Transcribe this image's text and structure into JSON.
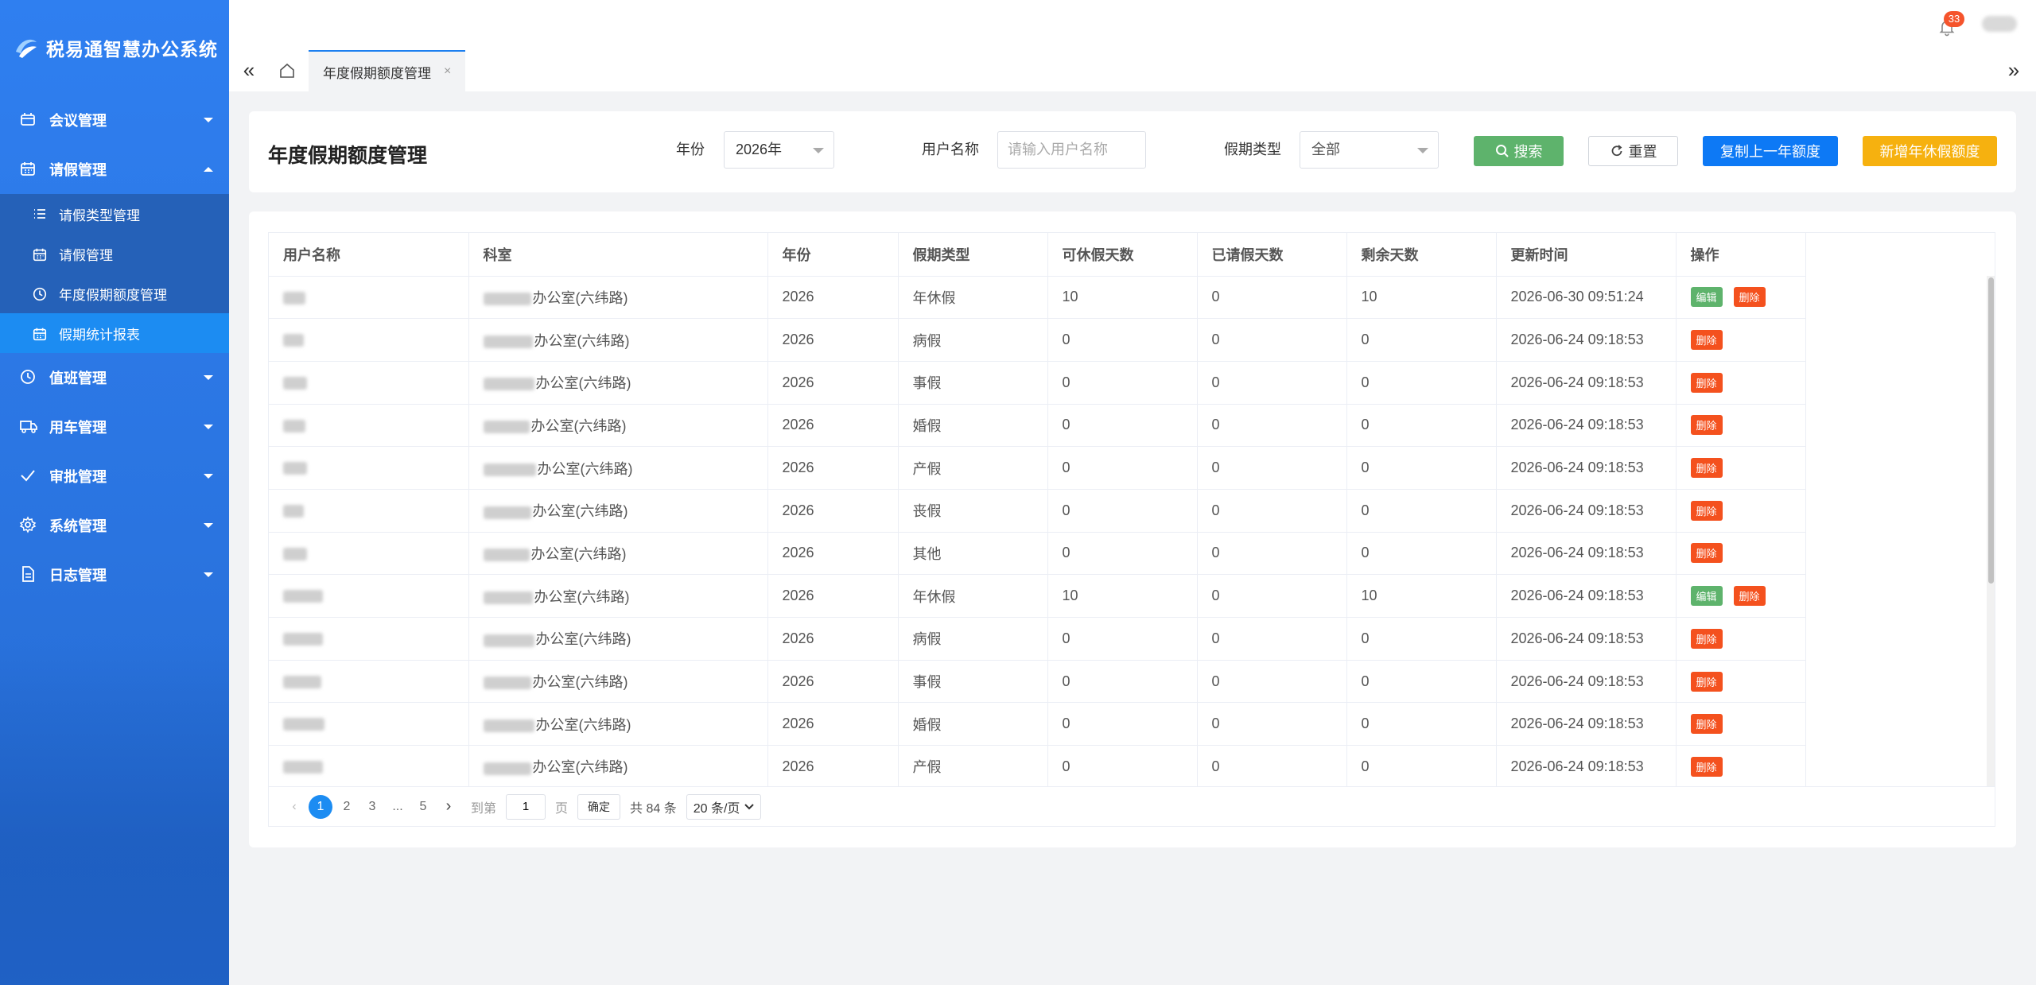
{
  "app": {
    "title": "税易通智慧办公系统"
  },
  "sidebar": {
    "menu": [
      {
        "label": "会议管理",
        "icon": "meeting-icon"
      },
      {
        "label": "请假管理",
        "icon": "calendar-icon",
        "expanded": true,
        "children": [
          {
            "label": "请假类型管理",
            "icon": "list-icon"
          },
          {
            "label": "请假管理",
            "icon": "calendar-icon"
          },
          {
            "label": "年度假期额度管理",
            "icon": "clock-icon"
          },
          {
            "label": "假期统计报表",
            "icon": "calendar-icon",
            "active": true
          }
        ]
      },
      {
        "label": "值班管理",
        "icon": "clock-icon"
      },
      {
        "label": "用车管理",
        "icon": "truck-icon"
      },
      {
        "label": "审批管理",
        "icon": "check-icon"
      },
      {
        "label": "系统管理",
        "icon": "gear-icon"
      },
      {
        "label": "日志管理",
        "icon": "document-icon"
      }
    ]
  },
  "header": {
    "notification_count": "33"
  },
  "tabs": [
    {
      "label": "年度假期额度管理",
      "close": "×"
    }
  ],
  "filter": {
    "page_title": "年度假期额度管理",
    "year_label": "年份",
    "year_value": "2026年",
    "user_label": "用户名称",
    "user_placeholder": "请输入用户名称",
    "type_label": "假期类型",
    "type_value": "全部",
    "search_btn": "搜索",
    "reset_btn": "重置",
    "copy_btn": "复制上一年额度",
    "add_btn": "新增年休假额度"
  },
  "table": {
    "headers": [
      "用户名称",
      "科室",
      "年份",
      "假期类型",
      "可休假天数",
      "已请假天数",
      "剩余天数",
      "更新时间",
      "操作"
    ],
    "dept_suffix": "办公室(六纬路)",
    "edit_label": "编辑",
    "delete_label": "删除",
    "rows": [
      {
        "year": "2026",
        "type": "年休假",
        "avail": "10",
        "used": "0",
        "left": "10",
        "updated": "2026-06-30 09:51:24",
        "editable": true
      },
      {
        "year": "2026",
        "type": "病假",
        "avail": "0",
        "used": "0",
        "left": "0",
        "updated": "2026-06-24 09:18:53",
        "editable": false
      },
      {
        "year": "2026",
        "type": "事假",
        "avail": "0",
        "used": "0",
        "left": "0",
        "updated": "2026-06-24 09:18:53",
        "editable": false
      },
      {
        "year": "2026",
        "type": "婚假",
        "avail": "0",
        "used": "0",
        "left": "0",
        "updated": "2026-06-24 09:18:53",
        "editable": false
      },
      {
        "year": "2026",
        "type": "产假",
        "avail": "0",
        "used": "0",
        "left": "0",
        "updated": "2026-06-24 09:18:53",
        "editable": false
      },
      {
        "year": "2026",
        "type": "丧假",
        "avail": "0",
        "used": "0",
        "left": "0",
        "updated": "2026-06-24 09:18:53",
        "editable": false
      },
      {
        "year": "2026",
        "type": "其他",
        "avail": "0",
        "used": "0",
        "left": "0",
        "updated": "2026-06-24 09:18:53",
        "editable": false
      },
      {
        "year": "2026",
        "type": "年休假",
        "avail": "10",
        "used": "0",
        "left": "10",
        "updated": "2026-06-24 09:18:53",
        "editable": true
      },
      {
        "year": "2026",
        "type": "病假",
        "avail": "0",
        "used": "0",
        "left": "0",
        "updated": "2026-06-24 09:18:53",
        "editable": false
      },
      {
        "year": "2026",
        "type": "事假",
        "avail": "0",
        "used": "0",
        "left": "0",
        "updated": "2026-06-24 09:18:53",
        "editable": false
      },
      {
        "year": "2026",
        "type": "婚假",
        "avail": "0",
        "used": "0",
        "left": "0",
        "updated": "2026-06-24 09:18:53",
        "editable": false
      },
      {
        "year": "2026",
        "type": "产假",
        "avail": "0",
        "used": "0",
        "left": "0",
        "updated": "2026-06-24 09:18:53",
        "editable": false
      }
    ]
  },
  "pagination": {
    "pages": [
      "1",
      "2",
      "3",
      "...",
      "5"
    ],
    "current": "1",
    "goto_label": "到第",
    "goto_value": "1",
    "page_unit": "页",
    "confirm": "确定",
    "total": "共 84 条",
    "page_size": "20 条/页"
  }
}
